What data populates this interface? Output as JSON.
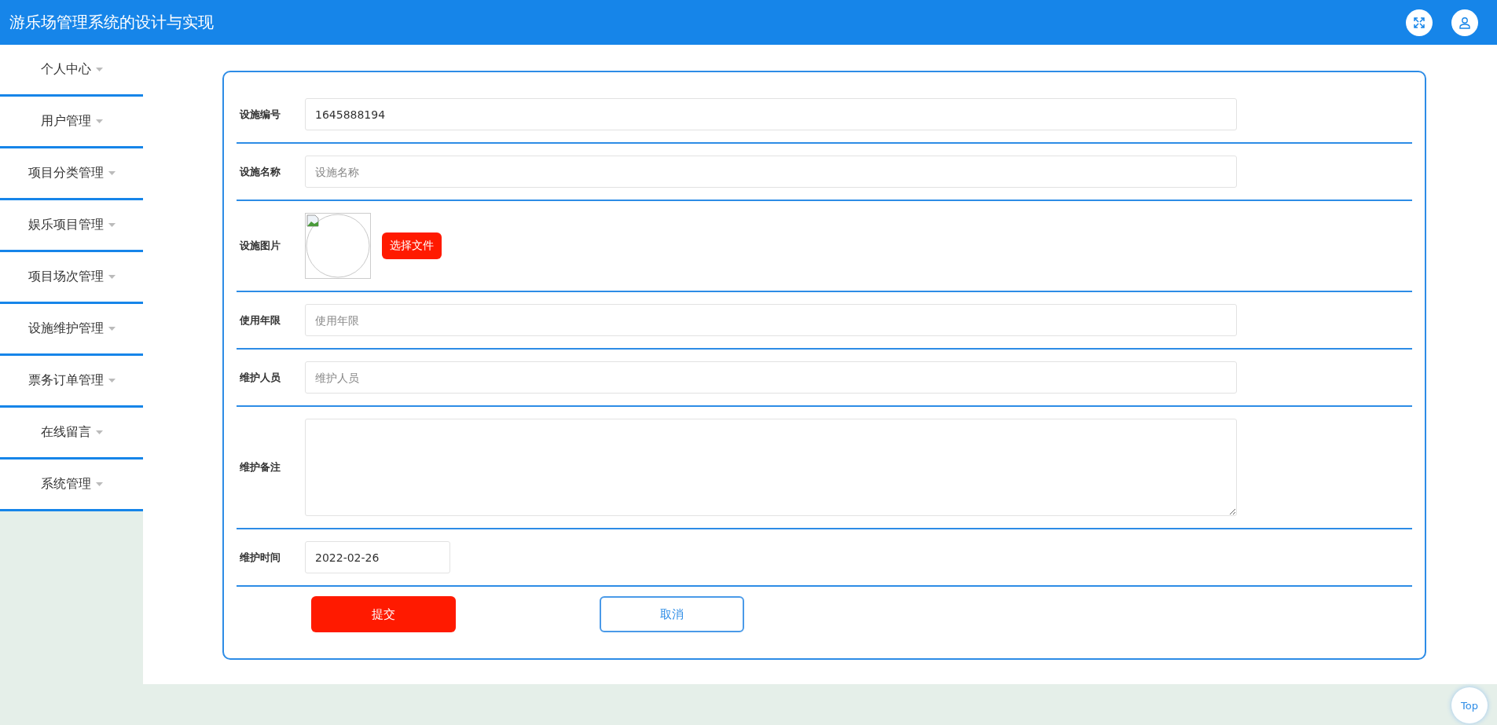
{
  "header": {
    "title": "游乐场管理系统的设计与实现"
  },
  "sidebar": {
    "items": [
      {
        "label": "个人中心"
      },
      {
        "label": "用户管理"
      },
      {
        "label": "项目分类管理"
      },
      {
        "label": "娱乐项目管理"
      },
      {
        "label": "项目场次管理"
      },
      {
        "label": "设施维护管理"
      },
      {
        "label": "票务订单管理"
      },
      {
        "label": "在线留言"
      },
      {
        "label": "系统管理"
      }
    ]
  },
  "form": {
    "fields": [
      {
        "kind": "text",
        "label": "设施编号",
        "value": "1645888194"
      },
      {
        "kind": "text",
        "label": "设施名称",
        "placeholder": "设施名称"
      },
      {
        "kind": "image",
        "label": "设施图片",
        "button": "选择文件"
      },
      {
        "kind": "text",
        "label": "使用年限",
        "placeholder": "使用年限"
      },
      {
        "kind": "text",
        "label": "维护人员",
        "placeholder": "维护人员"
      },
      {
        "kind": "textarea",
        "label": "维护备注"
      },
      {
        "kind": "date",
        "label": "维护时间",
        "value": "2022-02-26"
      }
    ],
    "submit": "提交",
    "cancel": "取消"
  },
  "back_to_top": "Top"
}
